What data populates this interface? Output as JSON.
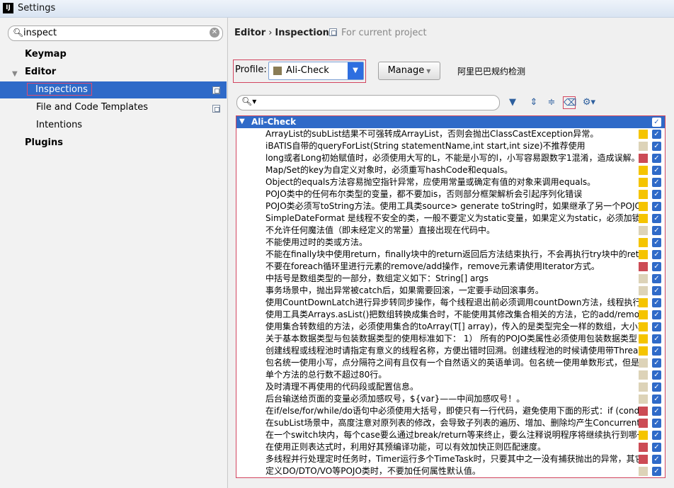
{
  "window": {
    "title": "Settings"
  },
  "sidebar": {
    "search_value": "inspect",
    "items": [
      {
        "label": "Keymap"
      },
      {
        "label": "Editor"
      },
      {
        "label": "Inspections"
      },
      {
        "label": "File and Code Templates"
      },
      {
        "label": "Intentions"
      },
      {
        "label": "Plugins"
      }
    ]
  },
  "header": {
    "breadcrumb_parent": "Editor",
    "breadcrumb_sep": "›",
    "breadcrumb_current": "Inspections",
    "scope_note": "For current project"
  },
  "profile": {
    "label": "Profile:",
    "value": "Ali-Check",
    "manage_label": "Manage",
    "description": "阿里巴巴规约检测"
  },
  "colors": {
    "selection": "#2f6ac8",
    "highlight_border": "#d2455f",
    "severity_warning": "#f5c400",
    "severity_error": "#cc4b55",
    "severity_weak": "#ddd3b8"
  },
  "inspections": {
    "group": "Ali-Check",
    "rows": [
      {
        "text": "ArrayList的subList结果不可强转成ArrayList，否则会抛出ClassCastException异常。",
        "severity": "warning"
      },
      {
        "text": "iBATIS自带的queryForList(String statementName,int start,int size)不推荐使用",
        "severity": "weak"
      },
      {
        "text": "long或者Long初始赋值时，必须使用大写的L，不能是小写的l，小写容易跟数字1混淆，造成误解。",
        "severity": "error"
      },
      {
        "text": "Map/Set的key为自定义对象时，必须重写hashCode和equals。",
        "severity": "warning"
      },
      {
        "text": "Object的equals方法容易抛空指针异常，应使用常量或确定有值的对象来调用equals。",
        "severity": "warning"
      },
      {
        "text": "POJO类中的任何布尔类型的变量，都不要加is，否则部分框架解析会引起序列化错误",
        "severity": "warning"
      },
      {
        "text": "POJO类必须写toString方法。使用工具类source> generate toString时，如果继承了另一个POJO类",
        "severity": "warning"
      },
      {
        "text": "SimpleDateFormat 是线程不安全的类，一般不要定义为static变量，如果定义为static，必须加锁",
        "severity": "warning"
      },
      {
        "text": "不允许任何魔法值（即未经定义的常量）直接出现在代码中。",
        "severity": "weak"
      },
      {
        "text": "不能使用过时的类或方法。",
        "severity": "warning"
      },
      {
        "text": "不能在finally块中使用return，finally块中的return返回后方法结束执行，不会再执行try块中的return语句",
        "severity": "warning"
      },
      {
        "text": "不要在foreach循环里进行元素的remove/add操作，remove元素请使用Iterator方式。",
        "severity": "error"
      },
      {
        "text": "中括号是数组类型的一部分，数组定义如下：String[] args",
        "severity": "weak"
      },
      {
        "text": "事务场景中，抛出异常被catch后，如果需要回滚，一定要手动回滚事务。",
        "severity": "weak"
      },
      {
        "text": "使用CountDownLatch进行异步转同步操作，每个线程退出前必须调用countDown方法，线程执行代码注意",
        "severity": "warning"
      },
      {
        "text": "使用工具类Arrays.asList()把数组转换成集合时，不能使用其修改集合相关的方法，它的add/remove/clear",
        "severity": "warning"
      },
      {
        "text": "使用集合转数组的方法，必须使用集合的toArray(T[] array)，传入的是类型完全一样的数组，大小就是list",
        "severity": "warning"
      },
      {
        "text": "关于基本数据类型与包装数据类型的使用标准如下：  1） 所有的POJO类属性必须使用包装数据类型",
        "severity": "warning"
      },
      {
        "text": "创建线程或线程池时请指定有意义的线程名称，方便出错时回溯。创建线程池的时候请使用带ThreadFactory",
        "severity": "warning"
      },
      {
        "text": "包名统一使用小写，点分隔符之间有且仅有一个自然语义的英语单词。包名统一使用单数形式，但是类名",
        "severity": "weak"
      },
      {
        "text": "单个方法的总行数不超过80行。",
        "severity": "weak"
      },
      {
        "text": "及时清理不再使用的代码段或配置信息。",
        "severity": "weak"
      },
      {
        "text": "后台输送给页面的变量必须加感叹号，${var}——中间加感叹号！。",
        "severity": "weak"
      },
      {
        "text": "在if/else/for/while/do语句中必须使用大括号，即使只有一行代码，避免使用下面的形式：if (condition)",
        "severity": "error"
      },
      {
        "text": "在subList场景中，高度注意对原列表的修改，会导致子列表的遍历、增加、删除均产生ConcurrentModificationException",
        "severity": "error"
      },
      {
        "text": "在一个switch块内，每个case要么通过break/return等来终止，要么注释说明程序将继续执行到哪一个case为止",
        "severity": "warning"
      },
      {
        "text": "在使用正则表达式时，利用好其预编译功能，可以有效加快正则匹配速度。",
        "severity": "error"
      },
      {
        "text": "多线程并行处理定时任务时，Timer运行多个TimeTask时，只要其中之一没有捕获抛出的异常，其它任务",
        "severity": "error"
      },
      {
        "text": "定义DO/DTO/VO等POJO类时，不要加任何属性默认值。",
        "severity": "weak"
      }
    ]
  }
}
